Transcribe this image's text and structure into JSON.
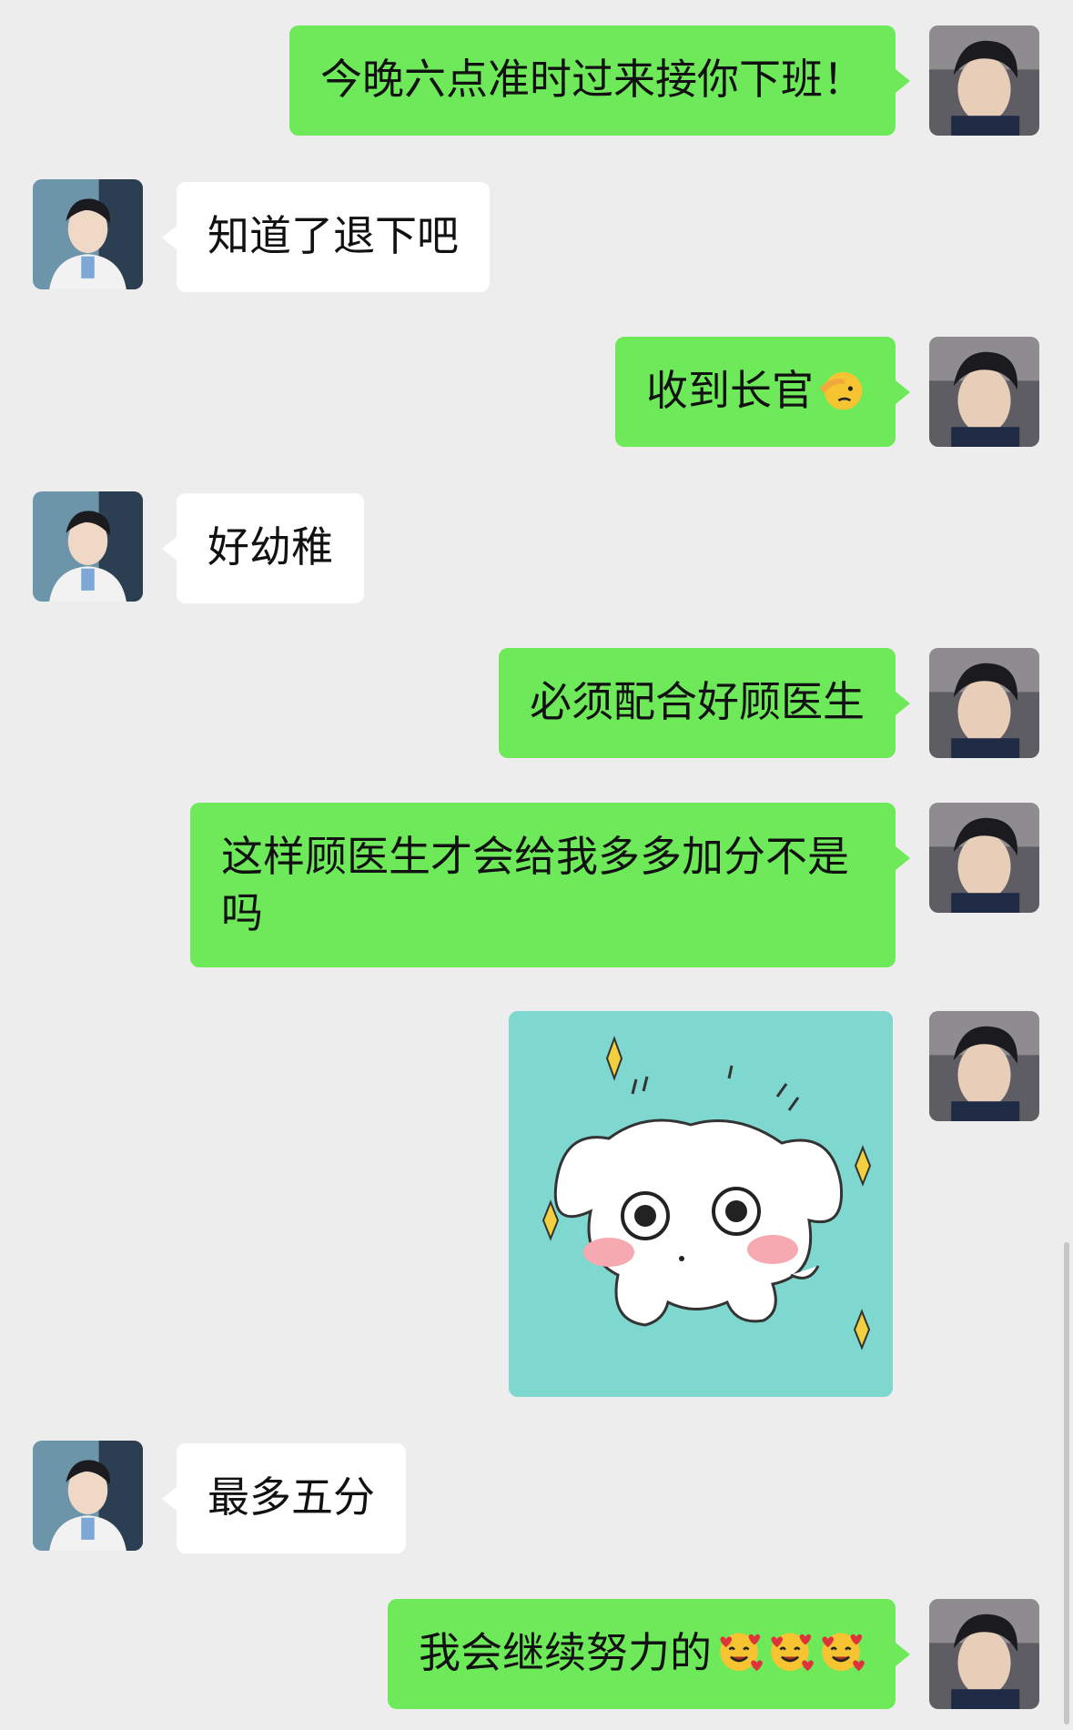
{
  "messages": [
    {
      "side": "right",
      "text": "今晚六点准时过来接你下班！"
    },
    {
      "side": "left",
      "text": "知道了退下吧"
    },
    {
      "side": "right",
      "text": "收到长官",
      "emoji": "salute-face-icon"
    },
    {
      "side": "left",
      "text": "好幼稚"
    },
    {
      "side": "right",
      "text": "必须配合好顾医生"
    },
    {
      "side": "right",
      "text": "这样顾医生才会给我多多加分不是吗"
    },
    {
      "side": "right",
      "sticker": "white-puppy-sticker"
    },
    {
      "side": "left",
      "text": "最多五分"
    },
    {
      "side": "right",
      "text": "我会继续努力的",
      "emoji": "smiling-face-with-hearts-icon"
    }
  ],
  "colors": {
    "background": "#ededed",
    "my_bubble": "#6ee95a",
    "their_bubble": "#ffffff",
    "sticker_bg": "#7fd8d0"
  }
}
